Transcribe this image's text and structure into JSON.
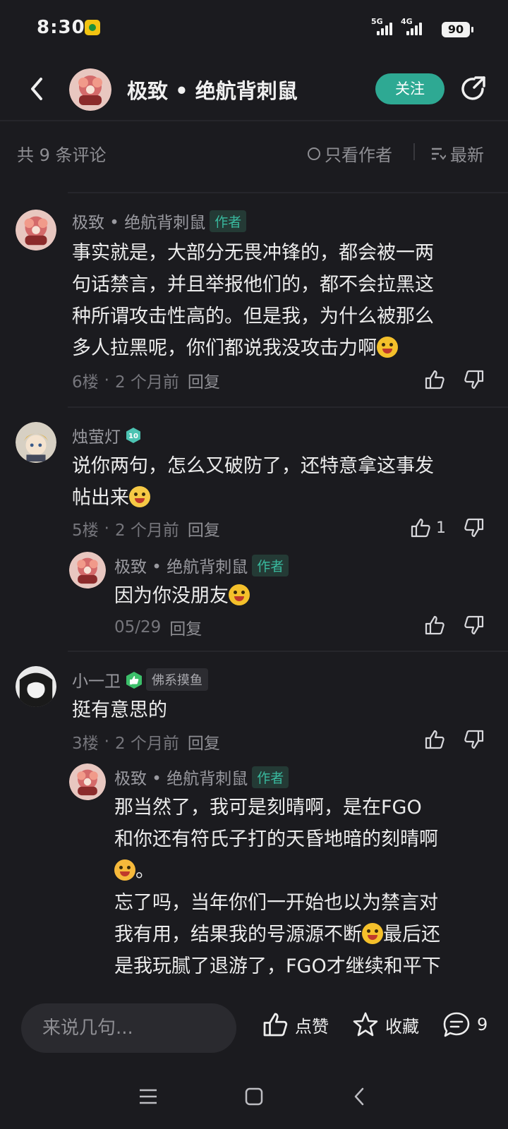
{
  "status_bar": {
    "time": "8:30",
    "signal1": "5G",
    "signal2": "4G",
    "battery": "90"
  },
  "header": {
    "title": "极致 • 绝航背刺鼠",
    "follow_label": "关注"
  },
  "filter": {
    "count_label": "共 9 条评论",
    "author_only_label": "只看作者",
    "sort_label": "最新"
  },
  "comments": [
    {
      "name": "极致 • 绝航背刺鼠",
      "tag": "作者",
      "lines": [
        "事实就是，大部分无畏冲锋的，都会被一两",
        "句话禁言，并且举报他们的，都不会拉黑这",
        "种所谓攻击性高的。但是我，为什么被那么",
        "多人拉黑呢，你们都说我没攻击力啊"
      ],
      "floor": "6楼",
      "time": "2 个月前",
      "reply": "回复",
      "likes": ""
    },
    {
      "name": "烛萤灯",
      "level": "10",
      "lines": [
        "说你两句，怎么又破防了，还特意拿这事发",
        "帖出来"
      ],
      "floor": "5楼",
      "time": "2 个月前",
      "reply": "回复",
      "likes": "1",
      "sub": {
        "name": "极致 • 绝航背刺鼠",
        "tag": "作者",
        "lines": [
          "因为你没朋友"
        ],
        "time": "05/29",
        "reply": "回复"
      }
    },
    {
      "name": "小一卫",
      "badge": "佛系摸鱼",
      "lines": [
        "挺有意思的"
      ],
      "floor": "3楼",
      "time": "2 个月前",
      "reply": "回复",
      "sub": {
        "name": "极致 • 绝航背刺鼠",
        "tag": "作者",
        "lines": [
          "那当然了，我可是刻晴啊，是在FGO",
          "和你还有符氏子打的天昏地暗的刻晴啊",
          "。",
          "忘了吗，当年你们一开始也以为禁言对",
          "我有用，结果我的号源源不断",
          "最后还",
          "是我玩腻了退游了，FGO才继续和平下"
        ]
      }
    }
  ],
  "bottom_bar": {
    "input_placeholder": "来说几句...",
    "like_label": "点赞",
    "fav_label": "收藏",
    "comment_count": "9"
  },
  "colors": {
    "background": "#1b1b1f",
    "accent": "#2ea993",
    "tag_text": "#39b99e"
  }
}
